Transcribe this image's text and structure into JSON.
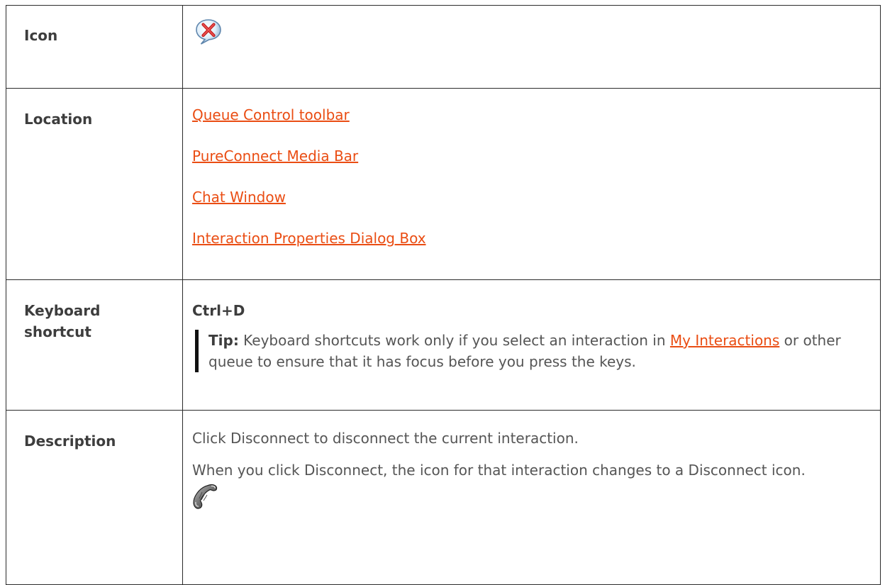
{
  "table": {
    "icon_label": "Icon",
    "icon_name": "disconnect-bubble-icon",
    "location_label": "Location",
    "locations": [
      "Queue Control toolbar",
      "PureConnect Media Bar",
      "Chat Window",
      "Interaction Properties Dialog Box"
    ],
    "keyboard_label": "Keyboard shortcut",
    "keyboard_shortcut": "Ctrl+D",
    "tip": {
      "prefix": "Tip:",
      "text_before": "Keyboard shortcuts work only if you select an interaction in",
      "link": "My Interactions",
      "text_after": "or other queue to ensure that it has focus before you press the keys."
    },
    "description_label": "Description",
    "description_1": "Click Disconnect to disconnect the current interaction.",
    "description_2": "When you click Disconnect, the icon for that interaction changes to a Disconnect icon.",
    "description_icon_name": "disconnected-phone-icon"
  },
  "colors": {
    "link": "#ea4d13",
    "text": "#555555",
    "border": "#2b2b2b"
  }
}
